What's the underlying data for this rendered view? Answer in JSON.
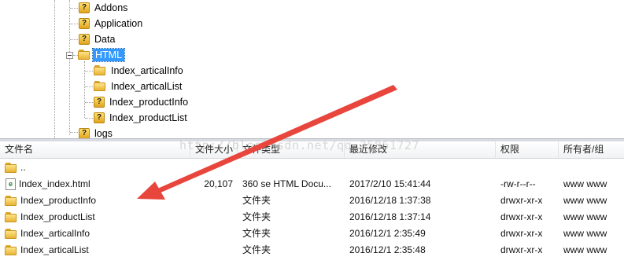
{
  "tree": {
    "items": [
      {
        "label": "Addons",
        "icon": "question-folder-icon"
      },
      {
        "label": "Application",
        "icon": "question-folder-icon"
      },
      {
        "label": "Data",
        "icon": "question-folder-icon"
      },
      {
        "label": "HTML",
        "icon": "folder-icon",
        "selected": true
      },
      {
        "label": "Index_articalInfo",
        "icon": "folder-icon"
      },
      {
        "label": "Index_articalList",
        "icon": "folder-icon"
      },
      {
        "label": "Index_productInfo",
        "icon": "question-folder-icon"
      },
      {
        "label": "Index_productList",
        "icon": "question-folder-icon"
      },
      {
        "label": "logs",
        "icon": "question-folder-icon"
      }
    ]
  },
  "list": {
    "columns": {
      "name": "文件名",
      "size": "文件大小",
      "type": "文件类型",
      "modified": "最近修改",
      "perms": "权限",
      "owner": "所有者/组"
    },
    "rows": [
      {
        "icon": "folder-icon",
        "name": "..",
        "size": "",
        "type": "",
        "modified": "",
        "perms": "",
        "owner": ""
      },
      {
        "icon": "html-file-icon",
        "name": "Index_index.html",
        "size": "20,107",
        "type": "360 se HTML Docu...",
        "modified": "2017/2/10 15:41:44",
        "perms": "-rw-r--r--",
        "owner": "www www"
      },
      {
        "icon": "folder-icon",
        "name": "Index_productInfo",
        "size": "",
        "type": "文件夹",
        "modified": "2016/12/18 1:37:38",
        "perms": "drwxr-xr-x",
        "owner": "www www"
      },
      {
        "icon": "folder-icon",
        "name": "Index_productList",
        "size": "",
        "type": "文件夹",
        "modified": "2016/12/18 1:37:14",
        "perms": "drwxr-xr-x",
        "owner": "www www"
      },
      {
        "icon": "folder-icon",
        "name": "Index_articalInfo",
        "size": "",
        "type": "文件夹",
        "modified": "2016/12/1 2:35:49",
        "perms": "drwxr-xr-x",
        "owner": "www www"
      },
      {
        "icon": "folder-icon",
        "name": "Index_articalList",
        "size": "",
        "type": "文件夹",
        "modified": "2016/12/1 2:35:48",
        "perms": "drwxr-xr-x",
        "owner": "www www"
      }
    ]
  },
  "watermark": "http://blog.csdn.net/qq_35861727",
  "colors": {
    "selection": "#3399ff",
    "arrow": "#e8453c",
    "folder": "#f2c44a"
  }
}
